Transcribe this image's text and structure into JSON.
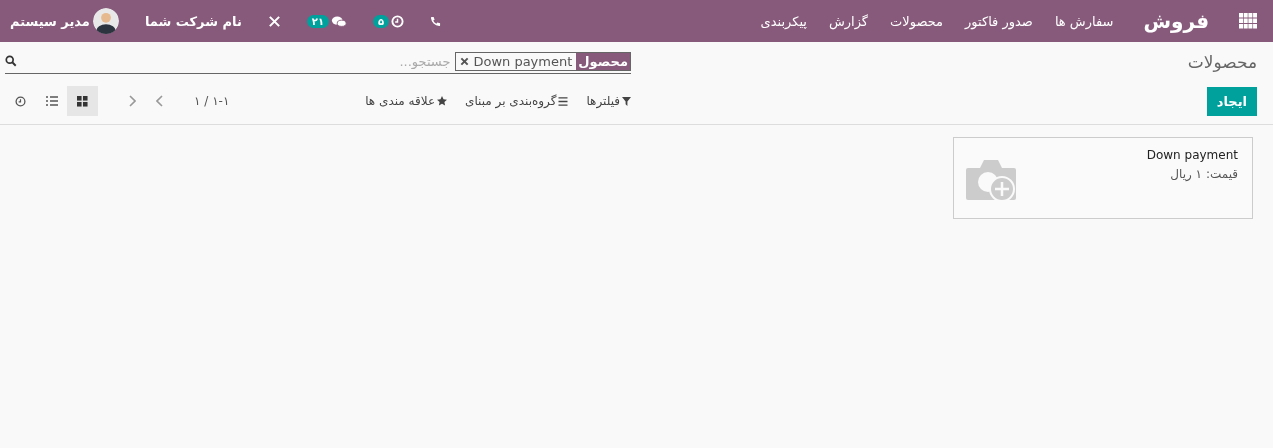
{
  "navbar": {
    "brand": "فروش",
    "menu": [
      "سفارش ها",
      "صدور فاکتور",
      "محصولات",
      "گزارش",
      "پیکربندی"
    ],
    "activity_count": "۵",
    "message_count": "۲۱",
    "company": "نام شرکت شما",
    "user": "مدیر سیستم"
  },
  "breadcrumb": "محصولات",
  "search": {
    "placeholder": "جستجو...",
    "facets": [
      {
        "label": "محصول",
        "value": "Down payment"
      }
    ]
  },
  "create_button": "ایجاد",
  "search_options": [
    {
      "kind": "filter",
      "label": "فیلترها"
    },
    {
      "kind": "group",
      "label": "گروه‌بندی بر مبنای"
    },
    {
      "kind": "favorite",
      "label": "علاقه مندی ها"
    }
  ],
  "pager": "۱-۱ / ۱",
  "views": [
    {
      "kind": "kanban",
      "selected": true
    },
    {
      "kind": "list",
      "selected": false
    },
    {
      "kind": "activity",
      "selected": false
    }
  ],
  "cards": [
    {
      "name": "Down payment",
      "price": "قیمت: ۱ ریال"
    }
  ]
}
